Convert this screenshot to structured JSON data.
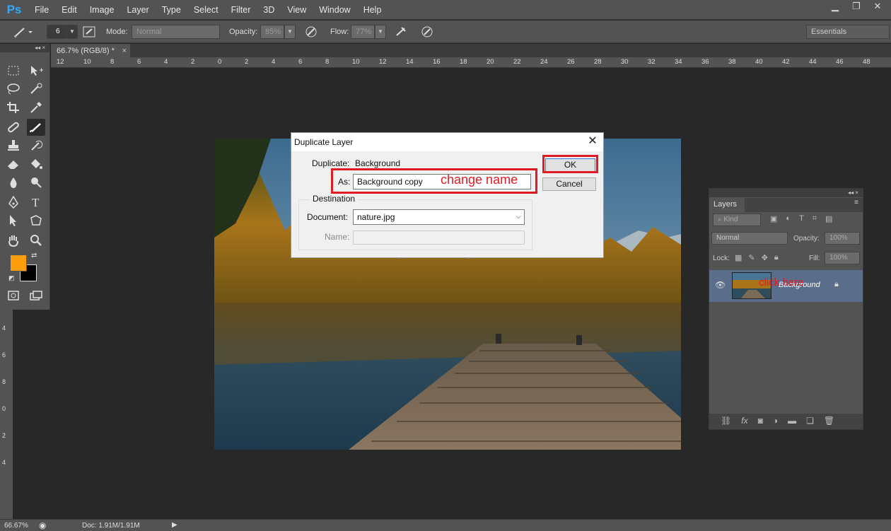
{
  "app": {
    "logo": "Ps"
  },
  "menu": [
    "File",
    "Edit",
    "Image",
    "Layer",
    "Type",
    "Select",
    "Filter",
    "3D",
    "View",
    "Window",
    "Help"
  ],
  "window_controls": [
    "minimize-icon",
    "restore-icon",
    "close-icon"
  ],
  "options_bar": {
    "brush_size": "6",
    "mode_label": "Mode:",
    "mode_value": "Normal",
    "opacity_label": "Opacity:",
    "opacity_value": "85%",
    "flow_label": "Flow:",
    "flow_value": "77%",
    "workspace": "Essentials"
  },
  "document_tab": {
    "title": "66.7% (RGB/8) *",
    "close": "×"
  },
  "ruler_top": [
    "12",
    "10",
    "8",
    "6",
    "4",
    "2",
    "0",
    "2",
    "4",
    "6",
    "8",
    "10",
    "12",
    "14",
    "16",
    "18",
    "20",
    "22",
    "24",
    "26",
    "28",
    "30",
    "32",
    "34",
    "36",
    "38",
    "40",
    "42",
    "44",
    "46",
    "48"
  ],
  "ruler_left": [
    "4",
    "6",
    "8",
    "0",
    "2",
    "4"
  ],
  "toolbox": {
    "collapse": "◂◂ ×",
    "tools": [
      "marquee-icon",
      "move-icon",
      "lasso-icon",
      "quick-select-icon",
      "crop-icon",
      "eyedropper-icon",
      "healing-icon",
      "brush-icon",
      "stamp-icon",
      "history-brush-icon",
      "eraser-icon",
      "paint-bucket-icon",
      "blur-icon",
      "dodge-icon",
      "pen-icon",
      "type-icon",
      "path-select-icon",
      "shape-icon",
      "hand-icon",
      "zoom-icon"
    ],
    "foreground_color": "#ff9d0a",
    "background_color": "#000000"
  },
  "dialog": {
    "title": "Duplicate Layer",
    "duplicate_label": "Duplicate:",
    "duplicate_value": "Background",
    "as_label": "As:",
    "as_value": "Background copy",
    "annotation_change": "change name",
    "ok": "OK",
    "cancel": "Cancel",
    "destination_legend": "Destination",
    "document_label": "Document:",
    "document_value": "nature.jpg",
    "name_label": "Name:",
    "name_value": "",
    "highlight_color": "#e01b24"
  },
  "layers_panel": {
    "collapse": "◂◂ ×",
    "tab": "Layers",
    "filter_kind": "Kind",
    "blend_mode": "Normal",
    "opacity_label": "Opacity:",
    "opacity_value": "100%",
    "lock_label": "Lock:",
    "fill_label": "Fill:",
    "fill_value": "100%",
    "layer_name": "Background",
    "annotation_click": "click here",
    "bottom_icons": [
      "link-icon",
      "fx-icon",
      "mask-icon",
      "adjustment-icon",
      "group-icon",
      "new-layer-icon",
      "trash-icon"
    ]
  },
  "status": {
    "zoom": "66.67%",
    "doc": "Doc: 1.91M/1.91M"
  }
}
